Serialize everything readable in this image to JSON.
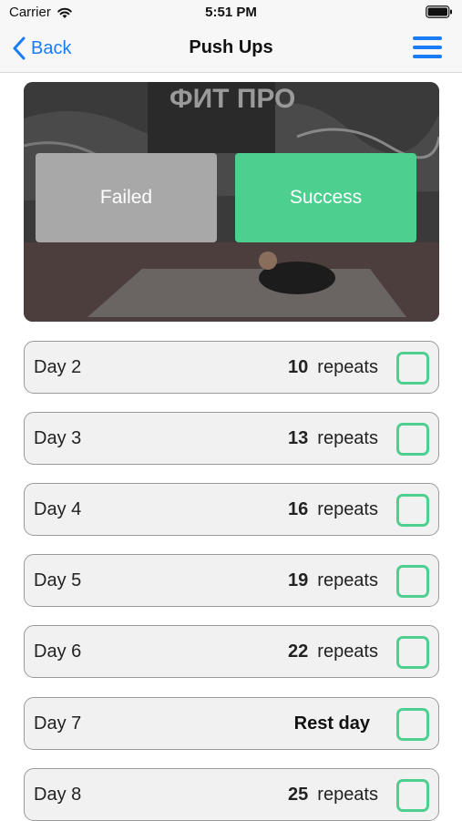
{
  "status_bar": {
    "carrier": "Carrier",
    "time": "5:51 PM"
  },
  "nav": {
    "back_label": "Back",
    "title": "Push Ups"
  },
  "hero": {
    "failed_label": "Failed",
    "success_label": "Success",
    "banner_text": "ФИТ ПРО"
  },
  "colors": {
    "accent": "#1a7cf5",
    "success": "#4ccf8f",
    "failed": "#a8a8a8"
  },
  "days": [
    {
      "label": "Day 2",
      "count": "10",
      "unit": "repeats",
      "rest": ""
    },
    {
      "label": "Day 3",
      "count": "13",
      "unit": "repeats",
      "rest": ""
    },
    {
      "label": "Day 4",
      "count": "16",
      "unit": "repeats",
      "rest": ""
    },
    {
      "label": "Day 5",
      "count": "19",
      "unit": "repeats",
      "rest": ""
    },
    {
      "label": "Day 6",
      "count": "22",
      "unit": "repeats",
      "rest": ""
    },
    {
      "label": "Day 7",
      "count": "",
      "unit": "",
      "rest": "Rest day"
    },
    {
      "label": "Day 8",
      "count": "25",
      "unit": "repeats",
      "rest": ""
    }
  ]
}
